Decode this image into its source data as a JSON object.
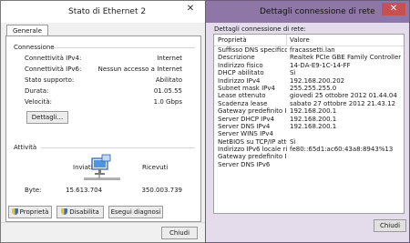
{
  "status_window": {
    "title": "Stato di Ethernet 2",
    "close_glyph": "✕",
    "tab_label": "Generale",
    "connection": {
      "heading": "Connessione",
      "rows": [
        {
          "label": "Connettività IPv4:",
          "value": "Internet"
        },
        {
          "label": "Connettività IPv6:",
          "value": "Nessun accesso a Internet"
        },
        {
          "label": "Stato supporto:",
          "value": "Abilitato"
        },
        {
          "label": "Durata:",
          "value": "01.05.55"
        },
        {
          "label": "Velocità:",
          "value": "1.0 Gbps"
        }
      ],
      "details_button": "Dettagli..."
    },
    "activity": {
      "heading": "Attività",
      "sent_label": "Inviati",
      "received_label": "Ricevuti",
      "bytes_label": "Byte:",
      "bytes_sent": "15.613.704",
      "bytes_received": "350.003.739"
    },
    "buttons": {
      "properties": "Proprietà",
      "disable": "Disabilita",
      "diagnose": "Esegui diagnosi",
      "close": "Chiudi"
    }
  },
  "details_window": {
    "title": "Dettagli connessione di rete",
    "close_glyph": "✕",
    "header": "Dettagli connessione di rete:",
    "columns": {
      "property": "Proprietà",
      "value": "Valore"
    },
    "rows": [
      {
        "property": "Suffisso DNS specifico d...",
        "value": "fracassetti.lan"
      },
      {
        "property": "Descrizione",
        "value": "Realtek PCIe GBE Family Controller"
      },
      {
        "property": "Indirizzo fisico",
        "value": "14-DA-E9-1C-14-FF"
      },
      {
        "property": "DHCP abilitato",
        "value": "Sì"
      },
      {
        "property": "Indirizzo IPv4",
        "value": "192.168.200.202"
      },
      {
        "property": "Subnet mask IPv4",
        "value": "255.255.255.0"
      },
      {
        "property": "Lease ottenuto",
        "value": "giovedì 25 ottobre 2012 01.44.04"
      },
      {
        "property": "Scadenza lease",
        "value": "sabato 27 ottobre 2012 21.43.12"
      },
      {
        "property": "Gateway predefinito IPv4",
        "value": "192.168.200.1"
      },
      {
        "property": "Server DHCP IPv4",
        "value": "192.168.200.1"
      },
      {
        "property": "Server DNS IPv4",
        "value": "192.168.200.1"
      },
      {
        "property": "Server WINS IPv4",
        "value": ""
      },
      {
        "property": "NetBIOS su TCP/IP atti...",
        "value": "Sì"
      },
      {
        "property": "Indirizzo IPv6 locale risp...",
        "value": "fe80::65d1:ac60:43a8:8943%13"
      },
      {
        "property": "Gateway predefinito IPv6",
        "value": ""
      },
      {
        "property": "Server DNS IPv6",
        "value": ""
      }
    ],
    "close_button": "Chiudi"
  },
  "colors": {
    "details_title_bar": "#8e77a6",
    "details_body": "#e4dcea",
    "close_button_red": "#c75050"
  }
}
